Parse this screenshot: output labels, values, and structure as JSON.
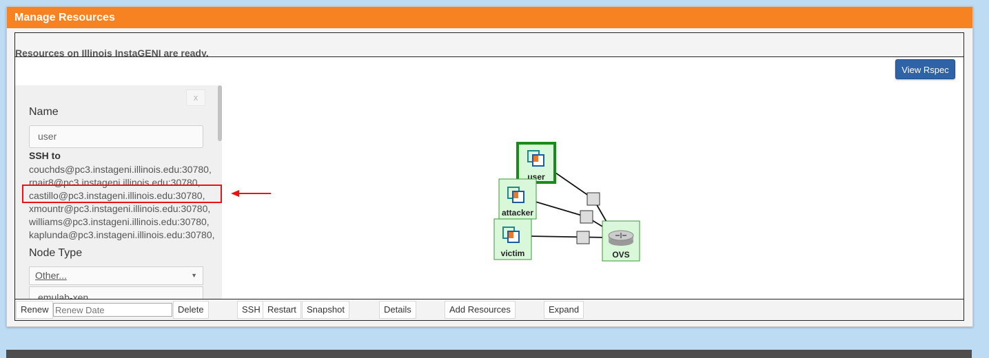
{
  "panel": {
    "title": "Manage Resources"
  },
  "status": {
    "message": "Resources on Illinois InstaGENI are ready."
  },
  "canvas": {
    "view_rspec_label": "View Rspec"
  },
  "side_panel": {
    "close_label": "x",
    "name_label": "Name",
    "name_value": "user",
    "ssh_heading": "SSH to",
    "ssh_logins": [
      "couchds@pc3.instageni.illinois.edu:30780,",
      "rnair8@pc3.instageni.illinois.edu:30780,",
      "castillo@pc3.instageni.illinois.edu:30780,",
      "xmountr@pc3.instageni.illinois.edu:30780,",
      "williams@pc3.instageni.illinois.edu:30780,",
      "kaplunda@pc3.instageni.illinois.edu:30780,"
    ],
    "node_type_label": "Node Type",
    "node_type_selected": "Other...",
    "node_type_value": "emulab-xen"
  },
  "topology": {
    "nodes": [
      {
        "name": "user",
        "selected": true
      },
      {
        "name": "attacker"
      },
      {
        "name": "victim"
      },
      {
        "name": "OVS",
        "type": "switch"
      }
    ]
  },
  "toolbar": {
    "renew_label": "Renew",
    "renew_date_placeholder": "Renew Date",
    "delete_label": "Delete",
    "ssh_label": "SSH",
    "restart_label": "Restart",
    "snapshot_label": "Snapshot",
    "details_label": "Details",
    "add_resources_label": "Add Resources",
    "expand_label": "Expand"
  },
  "colors": {
    "header": "#f68222",
    "page_background": "#bddcf3",
    "button_primary": "#2e63a8",
    "highlight": "#ee1111",
    "node_fill": "#d9f7d9",
    "selected_node_border": "#1a8a1a"
  }
}
